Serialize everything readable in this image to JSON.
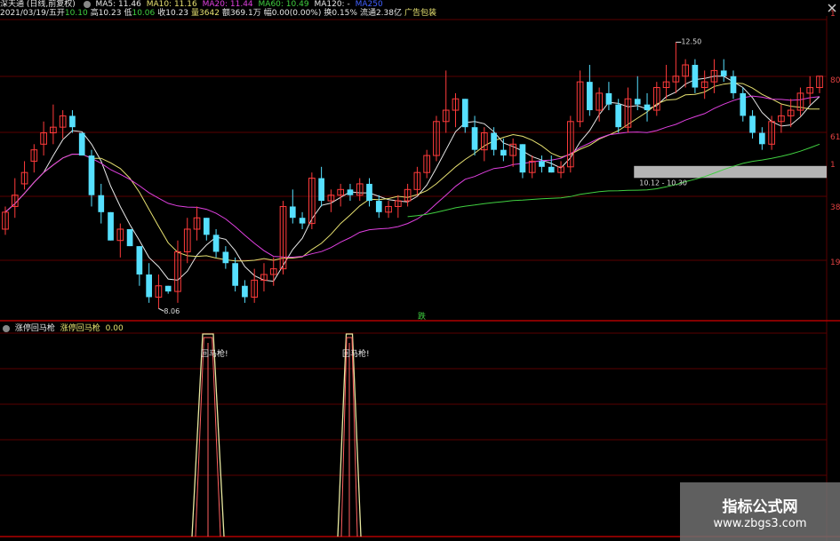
{
  "colors": {
    "up": "#ff3b3b",
    "down": "#56e0ff",
    "ma5": "#e8e8e8",
    "ma10": "#e6e070",
    "ma20": "#e040e0",
    "ma60": "#40d040",
    "ma120": "#4060ff",
    "grid": "#5a0000",
    "sep": "#b00000",
    "band": "#b4b4b4",
    "osc1": "#e8e8a0",
    "osc2": "#ff6060"
  },
  "header": {
    "title": "深天通 (日线,前复权)",
    "ma5": "MA5: 11.46",
    "ma10": "MA10: 11.16",
    "ma20": "MA20: 11.44",
    "ma60": "MA60: 10.49",
    "ma120": "MA120: -",
    "ma250": "MA250",
    "date": "2021/03/19/五",
    "open_l": "开",
    "open_v": "10.10",
    "high_l": "高",
    "high_v": "10.23",
    "low_l": "低",
    "low_v": "10.06",
    "close_l": "收",
    "close_v": "10.23",
    "vol": "量3642",
    "amt": "额369.1万",
    "chg": "幅0.00(0.00%)",
    "turn": "换0.15%",
    "float": "流通2.38亿",
    "ad": "广告包装"
  },
  "close_icon": "close-icon",
  "price_chart": {
    "right_labels": [
      "1",
      "80",
      "61",
      "1",
      "38",
      "19"
    ],
    "high_label": "12.50",
    "low_label": "8.06",
    "band_label": "10.12 - 10.30",
    "signal_label": "跌",
    "last_price": "11.9"
  },
  "indicator": {
    "name": "涨停回马枪",
    "name2": "涨停回马枪",
    "value": "0.00",
    "signal_texts": [
      "回马枪!",
      "回马枪!"
    ]
  },
  "watermark": {
    "title": "指标公式网",
    "url": "www.zbgs3.com"
  },
  "chart_data": {
    "type": "candlestick",
    "candles": [
      [
        9.2,
        9.6,
        9.1,
        9.5
      ],
      [
        9.6,
        10.1,
        9.4,
        9.8
      ],
      [
        10.0,
        10.4,
        9.9,
        10.2
      ],
      [
        10.4,
        10.7,
        10.2,
        10.6
      ],
      [
        10.7,
        11.1,
        10.5,
        10.9
      ],
      [
        10.9,
        11.4,
        10.7,
        11.0
      ],
      [
        11.0,
        11.3,
        10.8,
        11.2
      ],
      [
        11.2,
        11.3,
        10.9,
        11.0
      ],
      [
        10.9,
        10.9,
        10.5,
        10.5
      ],
      [
        10.5,
        10.6,
        9.6,
        9.8
      ],
      [
        9.8,
        10.0,
        9.3,
        9.5
      ],
      [
        9.5,
        9.5,
        9.0,
        9.0
      ],
      [
        9.0,
        9.3,
        8.7,
        9.2
      ],
      [
        9.2,
        9.2,
        8.9,
        8.9
      ],
      [
        8.9,
        8.9,
        8.2,
        8.4
      ],
      [
        8.4,
        8.6,
        7.9,
        8.0
      ],
      [
        8.0,
        8.4,
        7.8,
        8.2
      ],
      [
        8.2,
        8.2,
        8.06,
        8.1
      ],
      [
        8.1,
        9.0,
        7.9,
        8.8
      ],
      [
        8.8,
        9.4,
        8.6,
        9.2
      ],
      [
        9.2,
        9.6,
        9.0,
        9.4
      ],
      [
        9.4,
        9.4,
        9.0,
        9.1
      ],
      [
        9.1,
        9.2,
        8.7,
        8.8
      ],
      [
        8.8,
        8.9,
        8.5,
        8.6
      ],
      [
        8.6,
        8.7,
        8.1,
        8.2
      ],
      [
        8.2,
        8.3,
        7.9,
        8.0
      ],
      [
        8.0,
        8.5,
        7.9,
        8.3
      ],
      [
        8.3,
        8.6,
        8.1,
        8.4
      ],
      [
        8.4,
        8.7,
        8.2,
        8.5
      ],
      [
        8.5,
        9.7,
        8.4,
        9.6
      ],
      [
        9.6,
        9.9,
        9.3,
        9.4
      ],
      [
        9.4,
        9.5,
        9.2,
        9.3
      ],
      [
        9.3,
        10.2,
        9.2,
        10.1
      ],
      [
        10.1,
        10.3,
        9.6,
        9.7
      ],
      [
        9.7,
        9.9,
        9.5,
        9.8
      ],
      [
        9.8,
        10.0,
        9.6,
        9.9
      ],
      [
        9.9,
        10.0,
        9.7,
        9.8
      ],
      [
        9.8,
        10.1,
        9.7,
        10.0
      ],
      [
        10.0,
        10.1,
        9.6,
        9.7
      ],
      [
        9.7,
        9.8,
        9.4,
        9.5
      ],
      [
        9.5,
        9.7,
        9.4,
        9.6
      ],
      [
        9.6,
        9.8,
        9.4,
        9.7
      ],
      [
        9.7,
        10.0,
        9.6,
        9.9
      ],
      [
        9.9,
        10.3,
        9.8,
        10.2
      ],
      [
        10.2,
        10.6,
        10.1,
        10.5
      ],
      [
        10.5,
        11.2,
        10.4,
        11.1
      ],
      [
        11.1,
        12.0,
        10.9,
        11.3
      ],
      [
        11.3,
        11.6,
        11.0,
        11.5
      ],
      [
        11.5,
        11.5,
        10.9,
        11.0
      ],
      [
        11.0,
        11.2,
        10.5,
        10.6
      ],
      [
        10.6,
        11.0,
        10.4,
        10.9
      ],
      [
        10.9,
        11.0,
        10.5,
        10.6
      ],
      [
        10.6,
        10.8,
        10.4,
        10.5
      ],
      [
        10.5,
        10.8,
        10.3,
        10.7
      ],
      [
        10.7,
        10.7,
        10.1,
        10.2
      ],
      [
        10.2,
        10.5,
        10.1,
        10.4
      ],
      [
        10.4,
        10.5,
        10.2,
        10.3
      ],
      [
        10.3,
        10.5,
        10.2,
        10.2
      ],
      [
        10.2,
        10.4,
        10.1,
        10.3
      ],
      [
        10.3,
        11.2,
        10.2,
        11.1
      ],
      [
        11.1,
        12.0,
        11.0,
        11.8
      ],
      [
        11.8,
        12.1,
        11.2,
        11.3
      ],
      [
        11.3,
        11.7,
        11.1,
        11.6
      ],
      [
        11.6,
        11.8,
        11.3,
        11.4
      ],
      [
        11.4,
        11.5,
        10.9,
        11.0
      ],
      [
        11.0,
        11.7,
        10.9,
        11.5
      ],
      [
        11.5,
        11.9,
        11.3,
        11.4
      ],
      [
        11.4,
        11.6,
        11.1,
        11.3
      ],
      [
        11.3,
        11.8,
        11.2,
        11.7
      ],
      [
        11.7,
        12.1,
        11.5,
        11.8
      ],
      [
        11.8,
        12.5,
        11.6,
        11.9
      ],
      [
        11.9,
        12.2,
        11.7,
        12.1
      ],
      [
        12.1,
        12.2,
        11.6,
        11.7
      ],
      [
        11.7,
        12.0,
        11.5,
        11.8
      ],
      [
        11.8,
        12.2,
        11.6,
        12.0
      ],
      [
        12.0,
        12.2,
        11.8,
        11.9
      ],
      [
        11.9,
        12.0,
        11.5,
        11.6
      ],
      [
        11.6,
        11.7,
        11.1,
        11.2
      ],
      [
        11.2,
        11.3,
        10.8,
        10.9
      ],
      [
        10.9,
        11.0,
        10.6,
        10.7
      ],
      [
        10.7,
        11.2,
        10.6,
        11.1
      ],
      [
        11.1,
        11.4,
        10.9,
        11.2
      ],
      [
        11.2,
        11.5,
        11.0,
        11.3
      ],
      [
        11.3,
        11.7,
        11.2,
        11.6
      ],
      [
        11.6,
        11.9,
        11.4,
        11.7
      ],
      [
        11.7,
        11.9,
        11.6,
        11.9
      ]
    ],
    "ma_series": [
      {
        "name": "MA5",
        "color": "#e8e8e8"
      },
      {
        "name": "MA10",
        "color": "#e6e070"
      },
      {
        "name": "MA20",
        "color": "#e040e0"
      },
      {
        "name": "MA60",
        "color": "#40d040"
      }
    ],
    "band": [
      10.12,
      10.3
    ],
    "indicator_spikes": [
      {
        "index": 18,
        "value": 1.0
      },
      {
        "index": 32,
        "value": 1.0
      }
    ]
  }
}
